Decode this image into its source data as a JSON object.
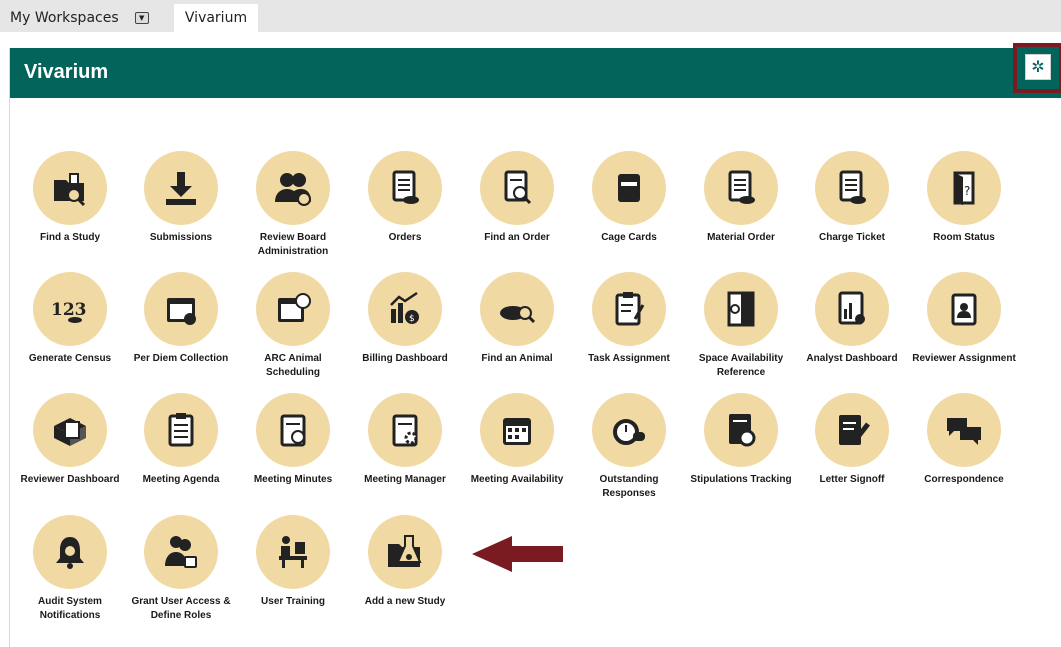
{
  "tabs": {
    "workspaces_label": "My Workspaces",
    "current_site": "Vivarium"
  },
  "header": {
    "title": "Vivarium"
  },
  "colors": {
    "header_bg": "#03645b",
    "circle_bg": "#f1d9a4",
    "highlight": "#7a1a21"
  },
  "tiles": [
    {
      "label": "Find a Study",
      "icon": "folder-search-icon"
    },
    {
      "label": "Submissions",
      "icon": "download-icon"
    },
    {
      "label": "Review Board Administration",
      "icon": "users-gear-icon"
    },
    {
      "label": "Orders",
      "icon": "document-rat-icon"
    },
    {
      "label": "Find an Order",
      "icon": "document-search-icon"
    },
    {
      "label": "Cage Cards",
      "icon": "card-icon"
    },
    {
      "label": "Material Order",
      "icon": "document-rat-icon"
    },
    {
      "label": "Charge Ticket",
      "icon": "document-rat-icon"
    },
    {
      "label": "Room Status",
      "icon": "door-question-icon"
    },
    {
      "label": "Generate Census",
      "icon": "numbers-rat-icon"
    },
    {
      "label": "Per Diem Collection",
      "icon": "calendar-check-icon"
    },
    {
      "label": "ARC Animal Scheduling",
      "icon": "calendar-clock-icon"
    },
    {
      "label": "Billing Dashboard",
      "icon": "chart-money-icon"
    },
    {
      "label": "Find an Animal",
      "icon": "rat-search-icon"
    },
    {
      "label": "Task Assignment",
      "icon": "clipboard-pen-icon"
    },
    {
      "label": "Space Availability Reference",
      "icon": "door-search-icon"
    },
    {
      "label": "Analyst Dashboard",
      "icon": "report-chart-icon"
    },
    {
      "label": "Reviewer Assignment",
      "icon": "badge-person-icon"
    },
    {
      "label": "Reviewer Dashboard",
      "icon": "box-documents-icon"
    },
    {
      "label": "Meeting Agenda",
      "icon": "clipboard-list-icon"
    },
    {
      "label": "Meeting Minutes",
      "icon": "notepad-clock-icon"
    },
    {
      "label": "Meeting Manager",
      "icon": "notepad-gear-icon"
    },
    {
      "label": "Meeting Availability",
      "icon": "calendar-icon"
    },
    {
      "label": "Outstanding Responses",
      "icon": "alarm-clock-icon"
    },
    {
      "label": "Stipulations Tracking",
      "icon": "document-seal-icon"
    },
    {
      "label": "Letter Signoff",
      "icon": "document-pen-icon"
    },
    {
      "label": "Correspondence",
      "icon": "chat-bubbles-icon"
    },
    {
      "label": "Audit System Notifications",
      "icon": "bell-search-icon"
    },
    {
      "label": "Grant User Access & Define Roles",
      "icon": "users-lock-icon"
    },
    {
      "label": "User Training",
      "icon": "person-desk-icon"
    },
    {
      "label": "Add a new Study",
      "icon": "folder-flask-icon"
    }
  ]
}
